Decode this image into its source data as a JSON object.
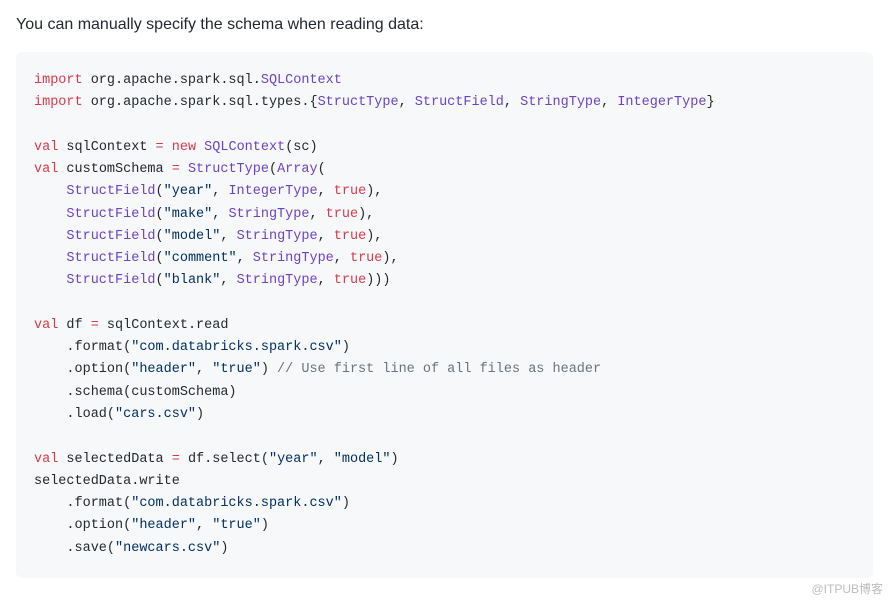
{
  "intro": "You can manually specify the schema when reading data:",
  "watermark": "@ITPUB博客",
  "code": {
    "l1": {
      "kw1": "import",
      "path": " org.apache.spark.sql.",
      "t1": "SQLContext"
    },
    "l2": {
      "kw1": "import",
      "path": " org.apache.spark.sql.types.{",
      "t1": "StructType",
      "c1": ", ",
      "t2": "StructField",
      "c2": ", ",
      "t3": "StringType",
      "c3": ", ",
      "t4": "IntegerType",
      "c4": "}"
    },
    "l3": {
      "kw1": "val",
      "v1": " sqlContext ",
      "op": "=",
      "sp": " ",
      "kw2": "new",
      "sp2": " ",
      "t1": "SQLContext",
      "p": "(sc)"
    },
    "l4": {
      "kw1": "val",
      "v1": " customSchema ",
      "op": "=",
      "sp": " ",
      "t1": "StructType",
      "p1": "(",
      "t2": "Array",
      "p2": "("
    },
    "l5": {
      "indent": "    ",
      "t1": "StructField",
      "p1": "(",
      "s1": "\"year\"",
      "c1": ", ",
      "t2": "IntegerType",
      "c2": ", ",
      "kw": "true",
      "p2": "),"
    },
    "l6": {
      "indent": "    ",
      "t1": "StructField",
      "p1": "(",
      "s1": "\"make\"",
      "c1": ", ",
      "t2": "StringType",
      "c2": ", ",
      "kw": "true",
      "p2": "),"
    },
    "l7": {
      "indent": "    ",
      "t1": "StructField",
      "p1": "(",
      "s1": "\"model\"",
      "c1": ", ",
      "t2": "StringType",
      "c2": ", ",
      "kw": "true",
      "p2": "),"
    },
    "l8": {
      "indent": "    ",
      "t1": "StructField",
      "p1": "(",
      "s1": "\"comment\"",
      "c1": ", ",
      "t2": "StringType",
      "c2": ", ",
      "kw": "true",
      "p2": "),"
    },
    "l9": {
      "indent": "    ",
      "t1": "StructField",
      "p1": "(",
      "s1": "\"blank\"",
      "c1": ", ",
      "t2": "StringType",
      "c2": ", ",
      "kw": "true",
      "p2": ")))"
    },
    "l10": {
      "kw1": "val",
      "v1": " df ",
      "op": "=",
      "rest": " sqlContext.read"
    },
    "l11": {
      "indent": "    ",
      "txt": ".format(",
      "s1": "\"com.databricks.spark.csv\"",
      "p": ")"
    },
    "l12": {
      "indent": "    ",
      "txt": ".option(",
      "s1": "\"header\"",
      "c1": ", ",
      "s2": "\"true\"",
      "p": ") ",
      "cmt": "// Use first line of all files as header"
    },
    "l13": {
      "indent": "    ",
      "txt": ".schema(customSchema)"
    },
    "l14": {
      "indent": "    ",
      "txt": ".load(",
      "s1": "\"cars.csv\"",
      "p": ")"
    },
    "l15": {
      "kw1": "val",
      "v1": " selectedData ",
      "op": "=",
      "rest": " df.select(",
      "s1": "\"year\"",
      "c1": ", ",
      "s2": "\"model\"",
      "p": ")"
    },
    "l16": {
      "txt": "selectedData.write"
    },
    "l17": {
      "indent": "    ",
      "txt": ".format(",
      "s1": "\"com.databricks.spark.csv\"",
      "p": ")"
    },
    "l18": {
      "indent": "    ",
      "txt": ".option(",
      "s1": "\"header\"",
      "c1": ", ",
      "s2": "\"true\"",
      "p": ")"
    },
    "l19": {
      "indent": "    ",
      "txt": ".save(",
      "s1": "\"newcars.csv\"",
      "p": ")"
    }
  }
}
